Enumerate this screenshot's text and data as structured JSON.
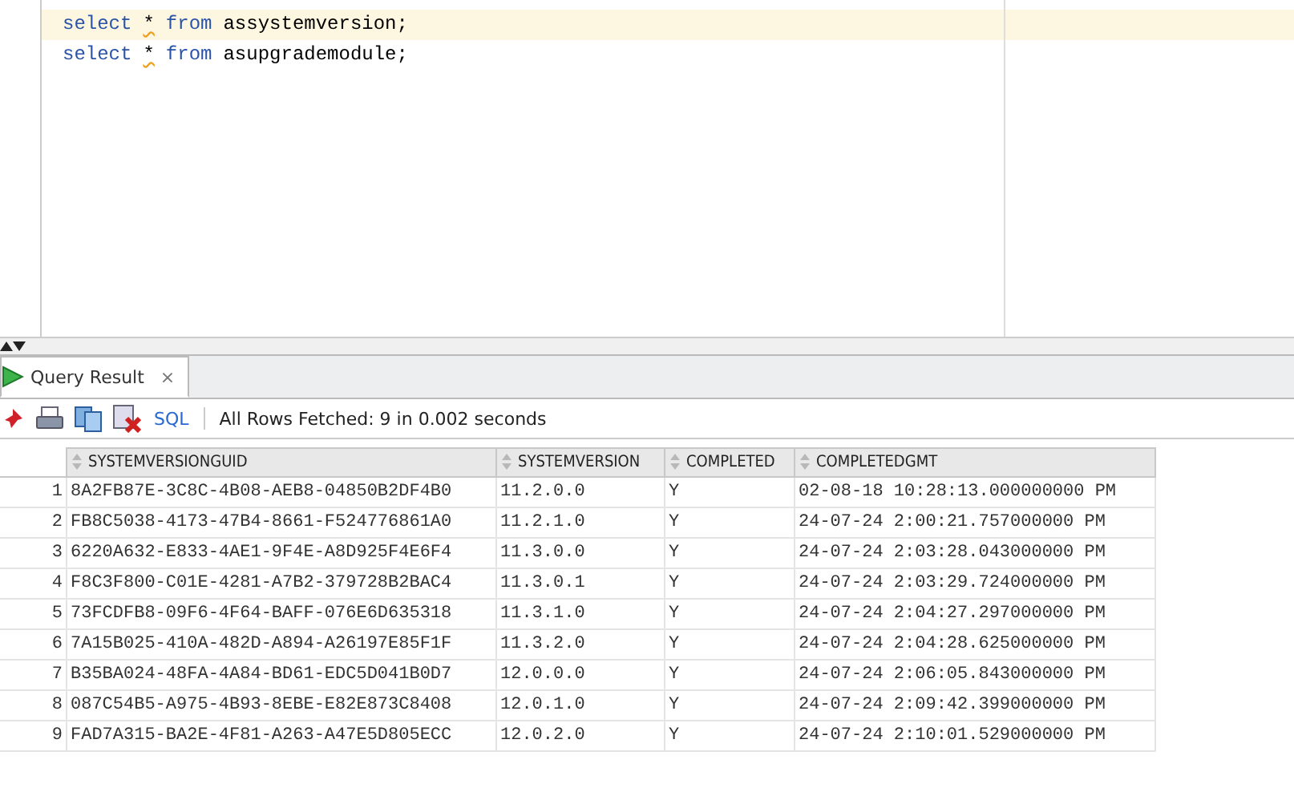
{
  "editor": {
    "lines": [
      {
        "current": true,
        "tokens": [
          {
            "kind": "keyword",
            "text": "select"
          },
          {
            "kind": "star",
            "text": "*"
          },
          {
            "kind": "keyword",
            "text": "from"
          },
          {
            "kind": "name",
            "text": "assystemversion;"
          }
        ]
      },
      {
        "current": false,
        "tokens": [
          {
            "kind": "keyword",
            "text": "select"
          },
          {
            "kind": "star",
            "text": "*"
          },
          {
            "kind": "keyword",
            "text": "from"
          },
          {
            "kind": "name",
            "text": "asupgrademodule;"
          }
        ]
      }
    ]
  },
  "result_tab": {
    "label": "Query Result",
    "close": "×",
    "selected": true
  },
  "toolbar": {
    "sql_label": "SQL",
    "status": "All Rows Fetched: 9 in 0.002 seconds"
  },
  "table": {
    "columns": [
      "",
      "SYSTEMVERSIONGUID",
      "SYSTEMVERSION",
      "COMPLETED",
      "COMPLETEDGMT"
    ],
    "rows": [
      [
        "1",
        "8A2FB87E-3C8C-4B08-AEB8-04850B2DF4B0",
        "11.2.0.0",
        "Y",
        "02-08-18 10:28:13.000000000 PM"
      ],
      [
        "2",
        "FB8C5038-4173-47B4-8661-F524776861A0",
        "11.2.1.0",
        "Y",
        "24-07-24 2:00:21.757000000 PM"
      ],
      [
        "3",
        "6220A632-E833-4AE1-9F4E-A8D925F4E6F4",
        "11.3.0.0",
        "Y",
        "24-07-24 2:03:28.043000000 PM"
      ],
      [
        "4",
        "F8C3F800-C01E-4281-A7B2-379728B2BAC4",
        "11.3.0.1",
        "Y",
        "24-07-24 2:03:29.724000000 PM"
      ],
      [
        "5",
        "73FCDFB8-09F6-4F64-BAFF-076E6D635318",
        "11.3.1.0",
        "Y",
        "24-07-24 2:04:27.297000000 PM"
      ],
      [
        "6",
        "7A15B025-410A-482D-A894-A26197E85F1F",
        "11.3.2.0",
        "Y",
        "24-07-24 2:04:28.625000000 PM"
      ],
      [
        "7",
        "B35BA024-48FA-4A84-BD61-EDC5D041B0D7",
        "12.0.0.0",
        "Y",
        "24-07-24 2:06:05.843000000 PM"
      ],
      [
        "8",
        "087C54B5-A975-4B93-8EBE-E82E873C8408",
        "12.0.1.0",
        "Y",
        "24-07-24 2:09:42.399000000 PM"
      ],
      [
        "9",
        "FAD7A315-BA2E-4F81-A263-A47E5D805ECC",
        "12.0.2.0",
        "Y",
        "24-07-24 2:10:01.529000000 PM"
      ]
    ]
  }
}
